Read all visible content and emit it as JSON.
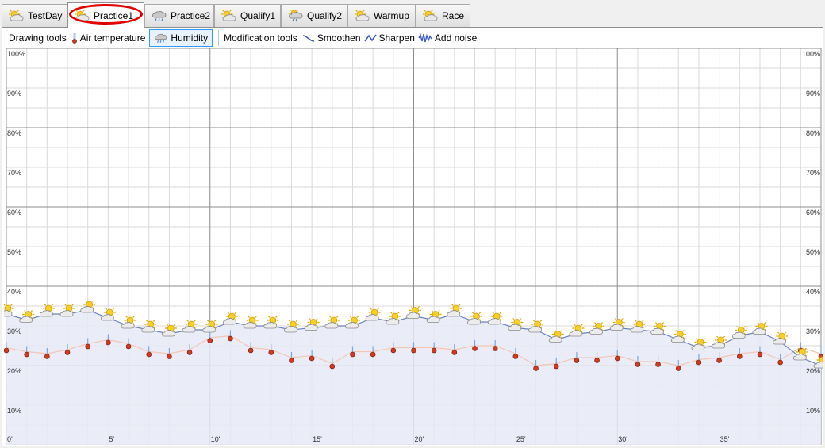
{
  "tabs": [
    {
      "label": "TestDay",
      "icon": "sun-cloud-icon",
      "active": false
    },
    {
      "label": "Practice1",
      "icon": "sun-cloud-icon",
      "active": true
    },
    {
      "label": "Practice2",
      "icon": "rain-cloud-icon",
      "active": false
    },
    {
      "label": "Qualify1",
      "icon": "sun-cloud-icon",
      "active": false
    },
    {
      "label": "Qualify2",
      "icon": "sun-rain-cloud-icon",
      "active": false
    },
    {
      "label": "Warmup",
      "icon": "sun-cloud-icon",
      "active": false
    },
    {
      "label": "Race",
      "icon": "sun-cloud-icon",
      "active": false
    }
  ],
  "toolbar": {
    "drawing_tools_label": "Drawing tools",
    "air_temperature_label": "Air temperature",
    "humidity_label": "Humidity",
    "modification_tools_label": "Modification tools",
    "smoothen_label": "Smoothen",
    "sharpen_label": "Sharpen",
    "add_noise_label": "Add noise"
  },
  "colors": {
    "humidity_line": "#6a84bf",
    "humidity_fill": "#e6e9f6",
    "temperature_line": "#f3c7b6",
    "highlight": "#e00000",
    "pressed_border": "#3399ff"
  },
  "chart_data": {
    "type": "line",
    "y_ticks": [
      "100%",
      "90%",
      "80%",
      "70%",
      "60%",
      "50%",
      "40%",
      "30%",
      "20%",
      "10%"
    ],
    "x_ticks": [
      "0'",
      "5'",
      "10'",
      "15'",
      "20'",
      "25'",
      "30'",
      "35'"
    ],
    "xlim": [
      0,
      40
    ],
    "ylim": [
      0,
      100
    ],
    "grid": true,
    "series": [
      {
        "x": [
          0,
          1,
          2,
          3,
          4,
          5,
          6,
          7,
          8,
          9,
          10,
          11,
          12,
          13,
          14,
          15,
          16,
          17,
          18,
          19,
          20,
          21,
          22,
          23,
          24,
          25,
          26,
          27,
          28,
          29,
          30,
          31,
          32,
          33,
          34,
          35,
          36,
          37,
          38,
          39,
          40
        ],
        "values": [
          33,
          31.5,
          33,
          33,
          34,
          32,
          30,
          29,
          28,
          29,
          29,
          31,
          30,
          30,
          29,
          29.5,
          30,
          30,
          32,
          31,
          32.5,
          31.5,
          33,
          31,
          31,
          29.5,
          29,
          26.5,
          28,
          28.5,
          29.5,
          29,
          28.5,
          26.5,
          24.5,
          25,
          27.5,
          28.5,
          26,
          22,
          20
        ]
      },
      {
        "x": [
          0,
          1,
          2,
          3,
          4,
          5,
          6,
          7,
          8,
          9,
          10,
          11,
          12,
          13,
          14,
          15,
          16,
          17,
          18,
          19,
          20,
          21,
          22,
          23,
          24,
          25,
          26,
          27,
          28,
          29,
          30,
          31,
          32,
          33,
          34,
          35,
          36,
          37,
          38,
          39,
          40
        ],
        "values": [
          24.5,
          23.5,
          23,
          24,
          25.5,
          26.5,
          25.5,
          23.5,
          23,
          24,
          27,
          27.5,
          24.5,
          24,
          22,
          22.5,
          20.5,
          23.5,
          23.5,
          24.5,
          24.5,
          24.5,
          24,
          25,
          25,
          23,
          20,
          20.5,
          22,
          22,
          22.5,
          21,
          21,
          20,
          21.5,
          22,
          23,
          23.5,
          21.5,
          24.5,
          23
        ]
      }
    ]
  }
}
